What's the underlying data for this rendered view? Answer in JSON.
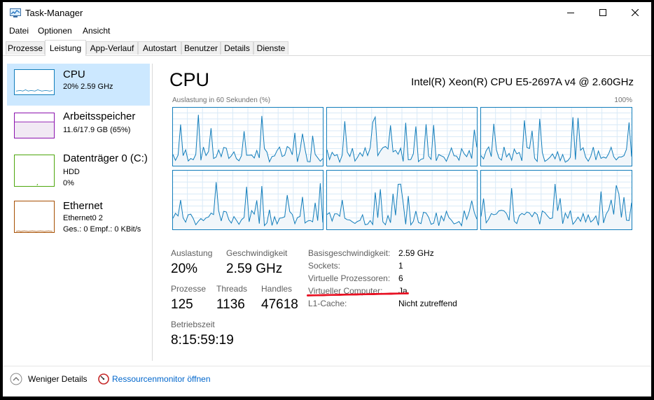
{
  "window": {
    "title": "Task-Manager",
    "app_icon": "task-manager-icon"
  },
  "menu": [
    "Datei",
    "Optionen",
    "Ansicht"
  ],
  "tabs": [
    {
      "label": "Prozesse",
      "active": false
    },
    {
      "label": "Leistung",
      "active": true
    },
    {
      "label": "App-Verlauf",
      "active": false
    },
    {
      "label": "Autostart",
      "active": false
    },
    {
      "label": "Benutzer",
      "active": false
    },
    {
      "label": "Details",
      "active": false
    },
    {
      "label": "Dienste",
      "active": false
    }
  ],
  "sidebar": [
    {
      "title": "CPU",
      "sub1": "20% 2.59 GHz",
      "sub2": "",
      "sub3": "",
      "color": "#117dbb",
      "selected": true
    },
    {
      "title": "Arbeitsspeicher",
      "sub1": "11.6/17.9 GB (65%)",
      "sub2": "",
      "sub3": "",
      "color": "#8b12ae",
      "selected": false
    },
    {
      "title": "Datenträger 0 (C:)",
      "sub1": "HDD",
      "sub2": "0%",
      "sub3": "",
      "color": "#4da60c",
      "selected": false
    },
    {
      "title": "Ethernet",
      "sub1": "Ethernet0 2",
      "sub2": "Ges.: 0 Empf.: 0 KBit/s",
      "sub3": "",
      "color": "#a74f01",
      "selected": false
    }
  ],
  "main": {
    "title": "CPU",
    "model": "Intel(R) Xeon(R) CPU E5-2697A v4 @ 2.60GHz",
    "graph_label": "Auslastung in 60 Sekunden (%)",
    "graph_max": "100%",
    "graph_color": "#117dbb"
  },
  "stats": {
    "utilization_label": "Auslastung",
    "utilization": "20%",
    "speed_label": "Geschwindigkeit",
    "speed": "2.59 GHz",
    "processes_label": "Prozesse",
    "processes": "125",
    "threads_label": "Threads",
    "threads": "1136",
    "handles_label": "Handles",
    "handles": "47618",
    "uptime_label": "Betriebszeit",
    "uptime": "8:15:59:19"
  },
  "details": [
    {
      "label": "Basisgeschwindigkeit:",
      "value": "2.59 GHz"
    },
    {
      "label": "Sockets:",
      "value": "1"
    },
    {
      "label": "Virtuelle Prozessoren:",
      "value": "6"
    },
    {
      "label": "Virtueller Computer:",
      "value": "Ja"
    },
    {
      "label": "L1-Cache:",
      "value": "Nicht zutreffend"
    }
  ],
  "footer": {
    "less_details": "Weniger Details",
    "resource_monitor": "Ressourcenmonitor öffnen"
  }
}
